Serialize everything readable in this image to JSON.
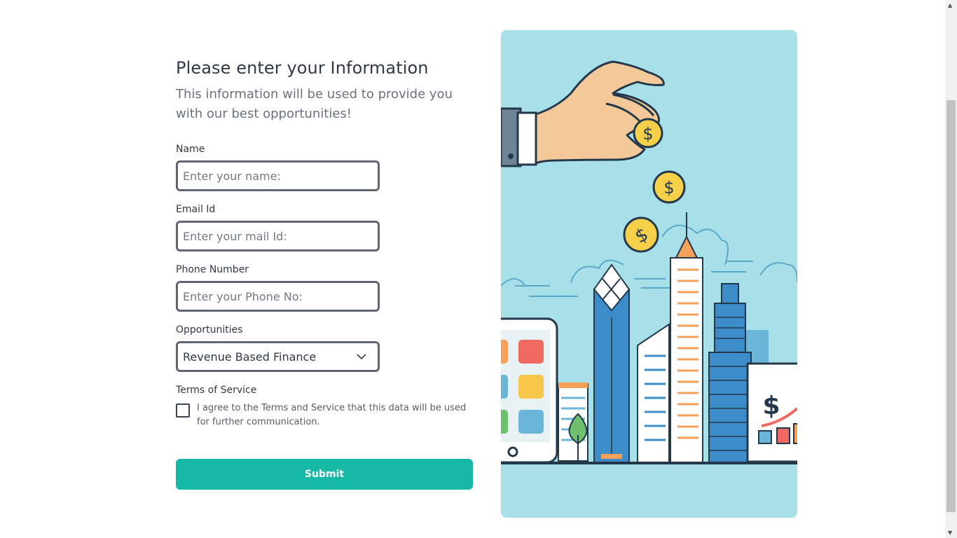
{
  "form": {
    "title": "Please enter your Information",
    "subtitle": "This information will be used to provide you with our best opportunities!",
    "name": {
      "label": "Name",
      "placeholder": "Enter your name:"
    },
    "email": {
      "label": "Email Id",
      "placeholder": "Enter your mail Id:"
    },
    "phone": {
      "label": "Phone Number",
      "placeholder": "Enter your Phone No:"
    },
    "opportunities": {
      "label": "Opportunities",
      "selected": "Revenue Based Finance"
    },
    "terms": {
      "label": "Terms of Service",
      "text": "I agree to the Terms and Service that this data will be used for further communication."
    },
    "submit_label": "Submit"
  },
  "colors": {
    "accent": "#16b9a5",
    "illustration_bg": "#a8e0ea",
    "input_border": "#5f6673"
  },
  "icons": {
    "select_arrow": "chevron-down-icon",
    "illustration": "finance-city-illustration"
  }
}
